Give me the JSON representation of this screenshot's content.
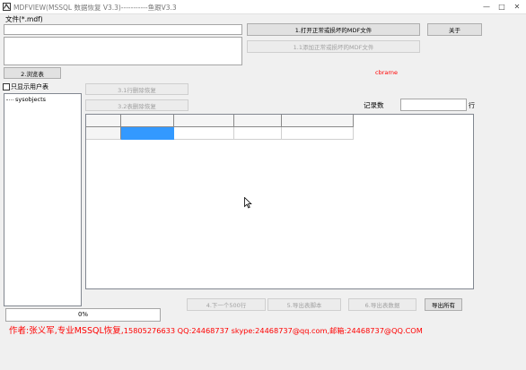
{
  "window": {
    "title": "MDFVIEW(MSSQL 数据恢复 V3.3)-----------鱼跟V3.3",
    "controls": {
      "minimize": "—",
      "maximize": "□",
      "close": "✕"
    }
  },
  "file_section": {
    "label": "文件(*.mdf)",
    "path_value": "",
    "open_button": "1.打开正常或损坏的MDF文件",
    "add_button": "1.1添加正常或损坏的MDF文件",
    "about_button": "关于"
  },
  "browse_button": "2.浏览表",
  "status_text": "cbrarne",
  "show_user_tables_label": "只显示用户表",
  "tree": {
    "items": [
      "sysobjects"
    ]
  },
  "delete_buttons": {
    "mark_delete": "3.1行删除恢复",
    "truncate_delete": "3.2表删除恢复"
  },
  "record_count": {
    "label": "记录数",
    "value": "",
    "unit": "行"
  },
  "bottom_buttons": {
    "next_page": "4.下一个500行",
    "export_script": "5.导出表脚本",
    "export_data": "6.导出表数据",
    "export_all": "导出所有"
  },
  "progress": {
    "text": "0%",
    "value": 0
  },
  "author": {
    "prefix": "作者:张义军,专业MSSQL恢复,",
    "contact": "15805276633 QQ:24468737 skype:24468737@qq.com,邮箱:24468737@QQ.COM"
  },
  "colors": {
    "accent": "#3399ff",
    "status": "#ff0000",
    "author": "#ff0000"
  }
}
